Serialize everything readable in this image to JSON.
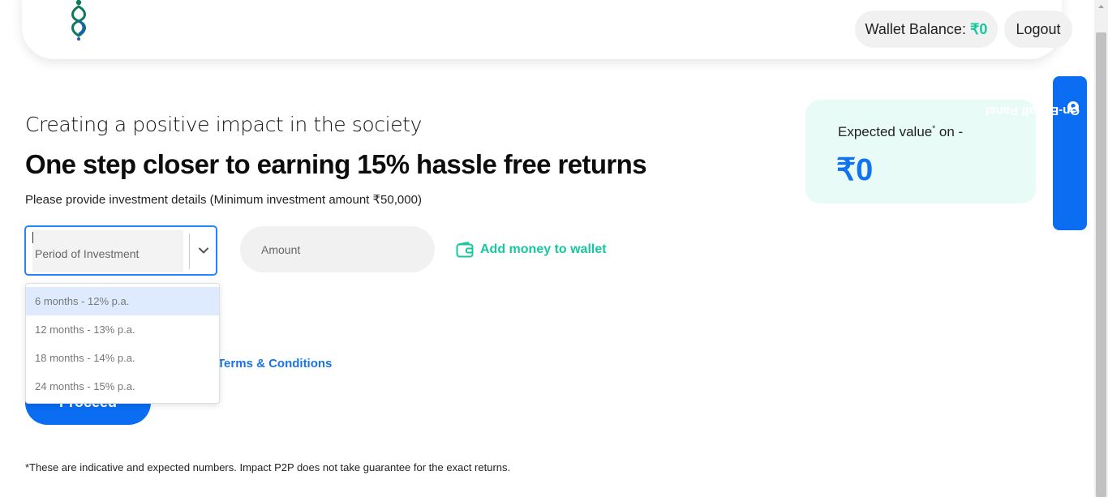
{
  "header": {
    "logo_icon": "infinity-leaf-logo",
    "wallet_label": "Wallet Balance:",
    "wallet_amount": "₹0",
    "logout_label": "Logout"
  },
  "main": {
    "subtitle": "Creating a positive impact in the society",
    "headline": "One step closer to earning 15% hassle free returns",
    "instruction": "Please provide investment details (Minimum investment amount ₹50,000)",
    "period_placeholder": "Period of Investment",
    "amount_placeholder": "Amount",
    "add_money_label": "Add money to wallet",
    "terms_label": "Terms & Conditions",
    "proceed_label": "Proceed",
    "period_options": [
      "6 months - 12% p.a.",
      "12 months - 13% p.a.",
      "18 months - 14% p.a.",
      "24 months - 15% p.a."
    ],
    "disclaimer": "*These are indicative and expected numbers. Impact P2P does not take guarantee for the exact returns."
  },
  "expected": {
    "label": "Expected value",
    "label_mark": "*",
    "label_suffix": " on -",
    "value": "₹0"
  },
  "side_tab": {
    "label": "On-Behalf Panel",
    "icon": "user-circle-icon"
  },
  "colors": {
    "primary": "#0a6df2",
    "accent": "#16c7a0",
    "card_bg": "#e8fbf7",
    "focus": "#2684ff"
  }
}
